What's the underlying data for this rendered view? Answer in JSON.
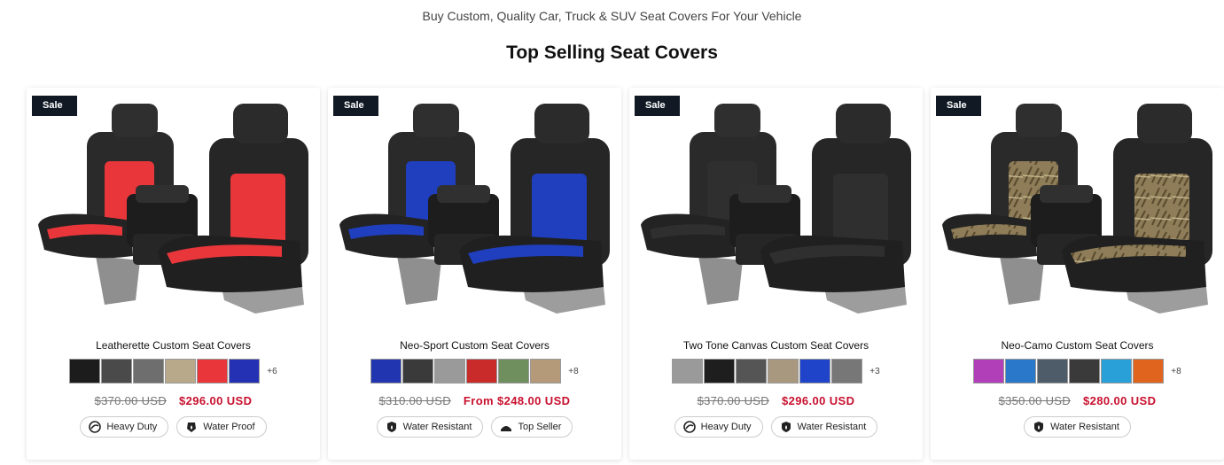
{
  "header": {
    "subtitle": "Buy Custom, Quality Car, Truck & SUV Seat Covers For Your Vehicle",
    "title": "Top Selling Seat Covers"
  },
  "products": [
    {
      "badge": "Sale",
      "title": "Leatherette Custom Seat Covers",
      "accent": "#e8363a",
      "swatches": [
        "#1c1c1c",
        "#4a4a4a",
        "#6e6e6e",
        "#b8a98a",
        "#e8363a",
        "#2531b5"
      ],
      "more": "+6",
      "old_price": "$370.00 USD",
      "new_price": "$296.00 USD",
      "tags": [
        {
          "label": "Heavy Duty",
          "icon": "heavy-duty-icon"
        },
        {
          "label": "Water Proof",
          "icon": "water-proof-icon"
        }
      ]
    },
    {
      "badge": "Sale",
      "title": "Neo-Sport Custom Seat Covers",
      "accent": "#1f3fbf",
      "swatches": [
        "#2235b0",
        "#3a3a3a",
        "#9a9a9a",
        "#c92a2a",
        "#6f8f5f",
        "#b49a78"
      ],
      "more": "+8",
      "old_price": "$310.00 USD",
      "new_price": "From $248.00 USD",
      "tags": [
        {
          "label": "Water Resistant",
          "icon": "water-resistant-icon"
        },
        {
          "label": "Top Seller",
          "icon": "top-seller-icon"
        }
      ]
    },
    {
      "badge": "Sale",
      "title": "Two Tone Canvas Custom Seat Covers",
      "accent": "#2f2f2f",
      "swatches": [
        "#9a9a9a",
        "#1e1e1e",
        "#555555",
        "#a89880",
        "#1f44c9",
        "#777777"
      ],
      "more": "+3",
      "old_price": "$370.00 USD",
      "new_price": "$296.00 USD",
      "tags": [
        {
          "label": "Heavy Duty",
          "icon": "heavy-duty-icon"
        },
        {
          "label": "Water Resistant",
          "icon": "water-resistant-icon"
        }
      ]
    },
    {
      "badge": "Sale",
      "title": "Neo-Camo Custom Seat Covers",
      "accent": "#9a8a62",
      "swatches": [
        "#b03fb8",
        "#2a78c9",
        "#4e5c6a",
        "#3a3a3a",
        "#2aa0d8",
        "#e0641e"
      ],
      "more": "+8",
      "old_price": "$350.00 USD",
      "new_price": "$280.00 USD",
      "tags": [
        {
          "label": "Water Resistant",
          "icon": "water-resistant-icon"
        }
      ]
    }
  ]
}
